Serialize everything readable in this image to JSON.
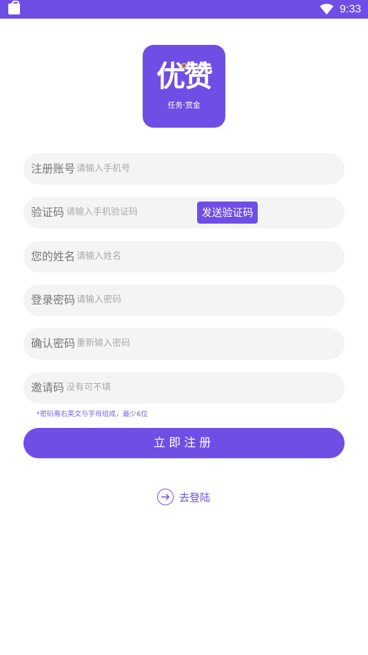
{
  "status_bar": {
    "time": "9:33"
  },
  "logo": {
    "brand": "优赞",
    "tagline": "任务·赏金"
  },
  "form": {
    "fields": [
      {
        "label": "注册账号",
        "placeholder": "请输入手机号"
      },
      {
        "label": "验证码",
        "placeholder": "请输入手机验证码",
        "action": "发送验证码"
      },
      {
        "label": "您的姓名",
        "placeholder": "请输入姓名"
      },
      {
        "label": "登录密码",
        "placeholder": "请输入密码"
      },
      {
        "label": "确认密码",
        "placeholder": "重新输入密码"
      },
      {
        "label": "邀请码",
        "placeholder": "没有可不填"
      }
    ],
    "hint": "*密码需右英文与字母组成，最少6位",
    "submit_label": "立即注册"
  },
  "footer": {
    "login_link": "去登陆"
  },
  "colors": {
    "accent": "#6f4ee6",
    "field_bg": "#f4f4f4"
  }
}
